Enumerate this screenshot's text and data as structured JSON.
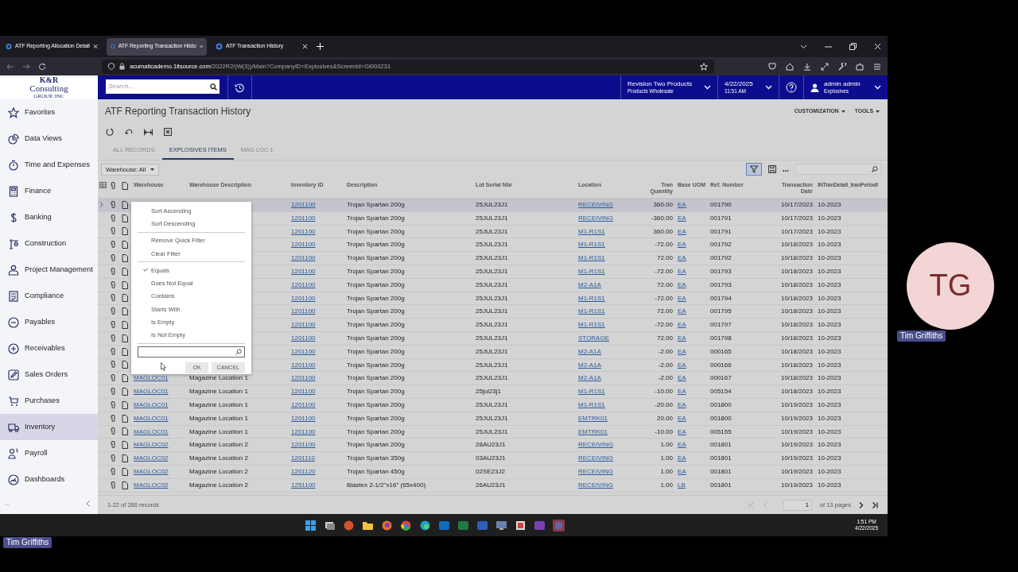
{
  "browser": {
    "tabs": [
      {
        "title": "ATF Reporting Allocation Detail",
        "selected": false
      },
      {
        "title": "ATF Reporting Transaction Histo",
        "selected": true
      },
      {
        "title": "ATF Transaction History",
        "selected": false
      }
    ],
    "url_host": "acumaticademo.1itsource.com",
    "url_path": "/2022R2/(W(3))/Main?CompanyID=Explosives&ScreenId=GI000231"
  },
  "app": {
    "logo": {
      "line_1": "K&R",
      "line_2": "Consulting",
      "line_3": "GROUP, INC"
    },
    "search": {
      "placeholder": "Search..."
    },
    "company": {
      "name": "Revision Two Products",
      "branch": "Products Wholesale"
    },
    "business_date": {
      "date": "4/22/2025",
      "time": "11:51 AM"
    },
    "user": {
      "name": "admin admin",
      "tenant": "Explosives"
    }
  },
  "sidebar": {
    "items": [
      {
        "label": "Favorites",
        "selected": false
      },
      {
        "label": "Data Views",
        "selected": false
      },
      {
        "label": "Time and Expenses",
        "selected": false
      },
      {
        "label": "Finance",
        "selected": false
      },
      {
        "label": "Banking",
        "selected": false
      },
      {
        "label": "Construction",
        "selected": false
      },
      {
        "label": "Project Management",
        "selected": false
      },
      {
        "label": "Compliance",
        "selected": false
      },
      {
        "label": "Payables",
        "selected": false
      },
      {
        "label": "Receivables",
        "selected": false
      },
      {
        "label": "Sales Orders",
        "selected": false
      },
      {
        "label": "Purchases",
        "selected": false
      },
      {
        "label": "Inventory",
        "selected": true
      },
      {
        "label": "Payroll",
        "selected": false
      },
      {
        "label": "Dashboards",
        "selected": false
      }
    ],
    "more": "..."
  },
  "page": {
    "title": "ATF Reporting Transaction History",
    "menus": [
      "CUSTOMIZATION",
      "TOOLS"
    ],
    "tabs": [
      {
        "label": "ALL RECORDS",
        "selected": false
      },
      {
        "label": "EXPLOSIVES ITEMS",
        "selected": true
      },
      {
        "label": "MAG LOC 1",
        "selected": false
      }
    ],
    "filter_dropdown": "Warehouse: All",
    "filter_button_on": true,
    "more_button": "..."
  },
  "table": {
    "columns": [
      "Warehouse",
      "Warehouse Description",
      "Inventory ID",
      "Description",
      "Lot Serial Nbr",
      "Location",
      "Tran Quantity",
      "Base UOM",
      "Ref. Number",
      "Transaction Date",
      "INTranDetail_tranPeriodI"
    ],
    "rows": [
      {
        "selected": true,
        "inventory_id": "1201100",
        "description": "Trojan Spartan 200g",
        "lot_serial_nbr": "25JUL23J1",
        "location": "RECEIVING",
        "tran_quantity": "360.00",
        "base_uom": "EA",
        "ref_number": "001790",
        "transaction_date": "10/17/2023",
        "period": "10-2023"
      },
      {
        "selected": false,
        "inventory_id": "1201100",
        "description": "Trojan Spartan 200g",
        "lot_serial_nbr": "25JUL23J1",
        "location": "RECEIVING",
        "tran_quantity": "-360.00",
        "base_uom": "EA",
        "ref_number": "001791",
        "transaction_date": "10/17/2023",
        "period": "10-2023"
      },
      {
        "selected": false,
        "inventory_id": "1201100",
        "description": "Trojan Spartan 200g",
        "lot_serial_nbr": "25JUL23J1",
        "location": "M1-R1S1",
        "tran_quantity": "360.00",
        "base_uom": "EA",
        "ref_number": "001791",
        "transaction_date": "10/17/2023",
        "period": "10-2023"
      },
      {
        "selected": false,
        "inventory_id": "1201100",
        "description": "Trojan Spartan 200g",
        "lot_serial_nbr": "25JUL23J1",
        "location": "M1-R1S1",
        "tran_quantity": "-72.00",
        "base_uom": "EA",
        "ref_number": "001792",
        "transaction_date": "10/18/2023",
        "period": "10-2023"
      },
      {
        "selected": false,
        "inventory_id": "1201100",
        "description": "Trojan Spartan 200g",
        "lot_serial_nbr": "25JUL23J1",
        "location": "M1-R1S1",
        "tran_quantity": "72.00",
        "base_uom": "EA",
        "ref_number": "001792",
        "transaction_date": "10/18/2023",
        "period": "10-2023"
      },
      {
        "selected": false,
        "inventory_id": "1201100",
        "description": "Trojan Spartan 200g",
        "lot_serial_nbr": "25JUL23J1",
        "location": "M1-R1S1",
        "tran_quantity": "-72.00",
        "base_uom": "EA",
        "ref_number": "001793",
        "transaction_date": "10/18/2023",
        "period": "10-2023"
      },
      {
        "selected": false,
        "inventory_id": "1201100",
        "description": "Trojan Spartan 200g",
        "lot_serial_nbr": "25JUL23J1",
        "location": "M2-A1A",
        "tran_quantity": "72.00",
        "base_uom": "EA",
        "ref_number": "001793",
        "transaction_date": "10/18/2023",
        "period": "10-2023"
      },
      {
        "selected": false,
        "inventory_id": "1201100",
        "description": "Trojan Spartan 200g",
        "lot_serial_nbr": "25JUL23J1",
        "location": "M1-R1S1",
        "tran_quantity": "-72.00",
        "base_uom": "EA",
        "ref_number": "001794",
        "transaction_date": "10/18/2023",
        "period": "10-2023"
      },
      {
        "selected": false,
        "inventory_id": "1201100",
        "description": "Trojan Spartan 200g",
        "lot_serial_nbr": "25JUL23J1",
        "location": "M1-R1S1",
        "tran_quantity": "72.00",
        "base_uom": "EA",
        "ref_number": "001795",
        "transaction_date": "10/18/2023",
        "period": "10-2023"
      },
      {
        "selected": false,
        "inventory_id": "1201100",
        "description": "Trojan Spartan 200g",
        "lot_serial_nbr": "25JUL23J1",
        "location": "M1-R1S1",
        "tran_quantity": "-72.00",
        "base_uom": "EA",
        "ref_number": "001797",
        "transaction_date": "10/18/2023",
        "period": "10-2023"
      },
      {
        "selected": false,
        "inventory_id": "1201100",
        "description": "Trojan Spartan 200g",
        "lot_serial_nbr": "25JUL23J1",
        "location": "STORAGE",
        "tran_quantity": "72.00",
        "base_uom": "EA",
        "ref_number": "001798",
        "transaction_date": "10/18/2023",
        "period": "10-2023"
      },
      {
        "selected": false,
        "inventory_id": "1201100",
        "description": "Trojan Spartan 200g",
        "lot_serial_nbr": "25JUL23J1",
        "location": "M2-A1A",
        "tran_quantity": "-2.00",
        "base_uom": "EA",
        "ref_number": "000165",
        "transaction_date": "10/18/2023",
        "period": "10-2023"
      },
      {
        "selected": false,
        "inventory_id": "1201100",
        "description": "Trojan Spartan 200g",
        "lot_serial_nbr": "25JUL23J1",
        "location": "M2-A1A",
        "tran_quantity": "-2.00",
        "base_uom": "EA",
        "ref_number": "000166",
        "transaction_date": "10/18/2023",
        "period": "10-2023"
      },
      {
        "selected": false,
        "warehouse": "MAGLOC01",
        "warehouse_description": "Magazine Location 1",
        "inventory_id": "1201100",
        "description": "Trojan Spartan 200g",
        "lot_serial_nbr": "25JUL23J1",
        "location": "M2-A1A",
        "tran_quantity": "-2.00",
        "base_uom": "EA",
        "ref_number": "000167",
        "transaction_date": "10/18/2023",
        "period": "10-2023"
      },
      {
        "selected": false,
        "warehouse": "MAGLOC01",
        "warehouse_description": "Magazine Location 1",
        "inventory_id": "1201100",
        "description": "Trojan Spartan 200g",
        "lot_serial_nbr": "25jul23j1",
        "location": "M1-R1S1",
        "tran_quantity": "-10.00",
        "base_uom": "EA",
        "ref_number": "005154",
        "transaction_date": "10/18/2023",
        "period": "10-2023"
      },
      {
        "selected": false,
        "warehouse": "MAGLOC01",
        "warehouse_description": "Magazine Location 1",
        "inventory_id": "1201100",
        "description": "Trojan Spartan 200g",
        "lot_serial_nbr": "25JUL23J1",
        "location": "M1-R1S1",
        "tran_quantity": "-20.00",
        "base_uom": "EA",
        "ref_number": "001800",
        "transaction_date": "10/19/2023",
        "period": "10-2023"
      },
      {
        "selected": false,
        "warehouse": "MAGLOC01",
        "warehouse_description": "Magazine Location 1",
        "inventory_id": "1201100",
        "description": "Trojan Spartan 200g",
        "lot_serial_nbr": "25JUL23J1",
        "location": "EMTRK01",
        "tran_quantity": "20.00",
        "base_uom": "EA",
        "ref_number": "001800",
        "transaction_date": "10/19/2023",
        "period": "10-2023"
      },
      {
        "selected": false,
        "warehouse": "MAGLOC01",
        "warehouse_description": "Magazine Location 1",
        "inventory_id": "1201100",
        "description": "Trojan Spartan 200g",
        "lot_serial_nbr": "25JUL23J1",
        "location": "EMTRK01",
        "tran_quantity": "-10.00",
        "base_uom": "EA",
        "ref_number": "005155",
        "transaction_date": "10/19/2023",
        "period": "10-2023"
      },
      {
        "selected": false,
        "warehouse": "MAGLOC02",
        "warehouse_description": "Magazine Location 2",
        "inventory_id": "1201100",
        "description": "Trojan Spartan 200g",
        "lot_serial_nbr": "28AU23J1",
        "location": "RECEIVING",
        "tran_quantity": "1.00",
        "base_uom": "EA",
        "ref_number": "001801",
        "transaction_date": "10/19/2023",
        "period": "10-2023"
      },
      {
        "selected": false,
        "warehouse": "MAGLOC02",
        "warehouse_description": "Magazine Location 2",
        "inventory_id": "1201110",
        "description": "Trojan Spartan 350g",
        "lot_serial_nbr": "03AU23J1",
        "location": "RECEIVING",
        "tran_quantity": "1.00",
        "base_uom": "EA",
        "ref_number": "001801",
        "transaction_date": "10/19/2023",
        "period": "10-2023"
      },
      {
        "selected": false,
        "warehouse": "MAGLOC02",
        "warehouse_description": "Magazine Location 2",
        "inventory_id": "1201120",
        "description": "Trojan Spartan 450g",
        "lot_serial_nbr": "02SE23J2",
        "location": "RECEIVING",
        "tran_quantity": "1.00",
        "base_uom": "EA",
        "ref_number": "001801",
        "transaction_date": "10/19/2023",
        "period": "10-2023"
      },
      {
        "selected": false,
        "warehouse": "MAGLOC02",
        "warehouse_description": "Magazine Location 2",
        "inventory_id": "1251100",
        "description": "Blastex 2-1/2\"x16\" (65x400)",
        "lot_serial_nbr": "26AU23J1",
        "location": "RECEIVING",
        "tran_quantity": "1.00",
        "base_uom": "LB",
        "ref_number": "001801",
        "transaction_date": "10/19/2023",
        "period": "10-2023"
      }
    ]
  },
  "column_menu": {
    "groups": [
      [
        {
          "label": "Sort Ascending",
          "checked": false
        },
        {
          "label": "Sort Descending",
          "checked": false
        }
      ],
      [
        {
          "label": "Remove Quick Filter",
          "checked": false
        },
        {
          "label": "Clear Filter",
          "checked": false
        }
      ],
      [
        {
          "label": "Equals",
          "checked": true
        },
        {
          "label": "Does Not Equal",
          "checked": false
        },
        {
          "label": "Contains",
          "checked": false
        },
        {
          "label": "Starts With",
          "checked": false
        },
        {
          "label": "Is Empty",
          "checked": false
        },
        {
          "label": "Is Not Empty",
          "checked": false
        }
      ]
    ],
    "buttons": [
      "OK",
      "CANCEL"
    ]
  },
  "footer": {
    "records": "1-22 of 266 records",
    "page": "1",
    "pages": "of 13 pages"
  },
  "taskbar": {
    "time": "1:51 PM",
    "date": "4/22/2025"
  },
  "participant": {
    "initials": "TG",
    "name": "Tim Griffiths"
  },
  "presenter": "Tim Griffiths"
}
